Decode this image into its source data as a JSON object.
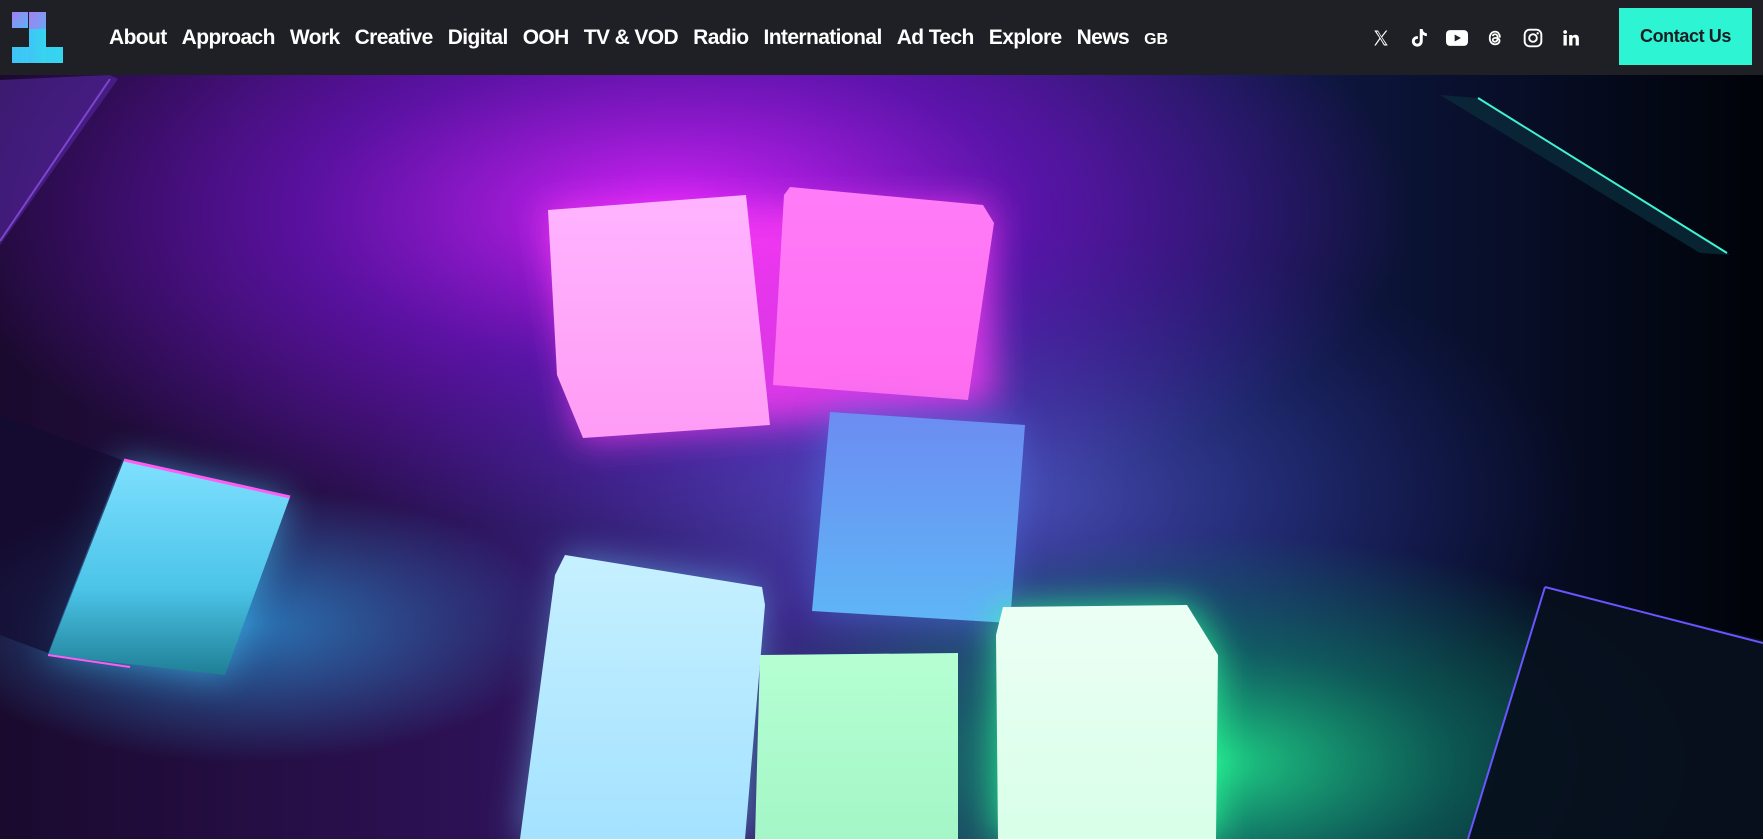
{
  "brand": {
    "logo_icon": "brand-logo-icon",
    "colors": {
      "logo_top": "#9b86f2",
      "logo_bottom": "#3ccbf5"
    }
  },
  "nav": {
    "items": [
      {
        "label": "About"
      },
      {
        "label": "Approach"
      },
      {
        "label": "Work"
      },
      {
        "label": "Creative"
      },
      {
        "label": "Digital"
      },
      {
        "label": "OOH"
      },
      {
        "label": "TV & VOD"
      },
      {
        "label": "Radio"
      },
      {
        "label": "International"
      },
      {
        "label": "Ad Tech"
      },
      {
        "label": "Explore"
      },
      {
        "label": "News"
      }
    ],
    "region": "GB"
  },
  "social": {
    "icons": [
      "x-twitter-icon",
      "tiktok-icon",
      "youtube-icon",
      "threads-icon",
      "instagram-icon",
      "linkedin-icon"
    ]
  },
  "contact": {
    "label": "Contact Us",
    "color": "#2df5d3"
  },
  "theme": {
    "nav_background": "#1f1f26",
    "nav_text": "#ffffff"
  },
  "hero": {
    "type": "background-video-frame",
    "description_icon": "glowing-cubes-image"
  }
}
